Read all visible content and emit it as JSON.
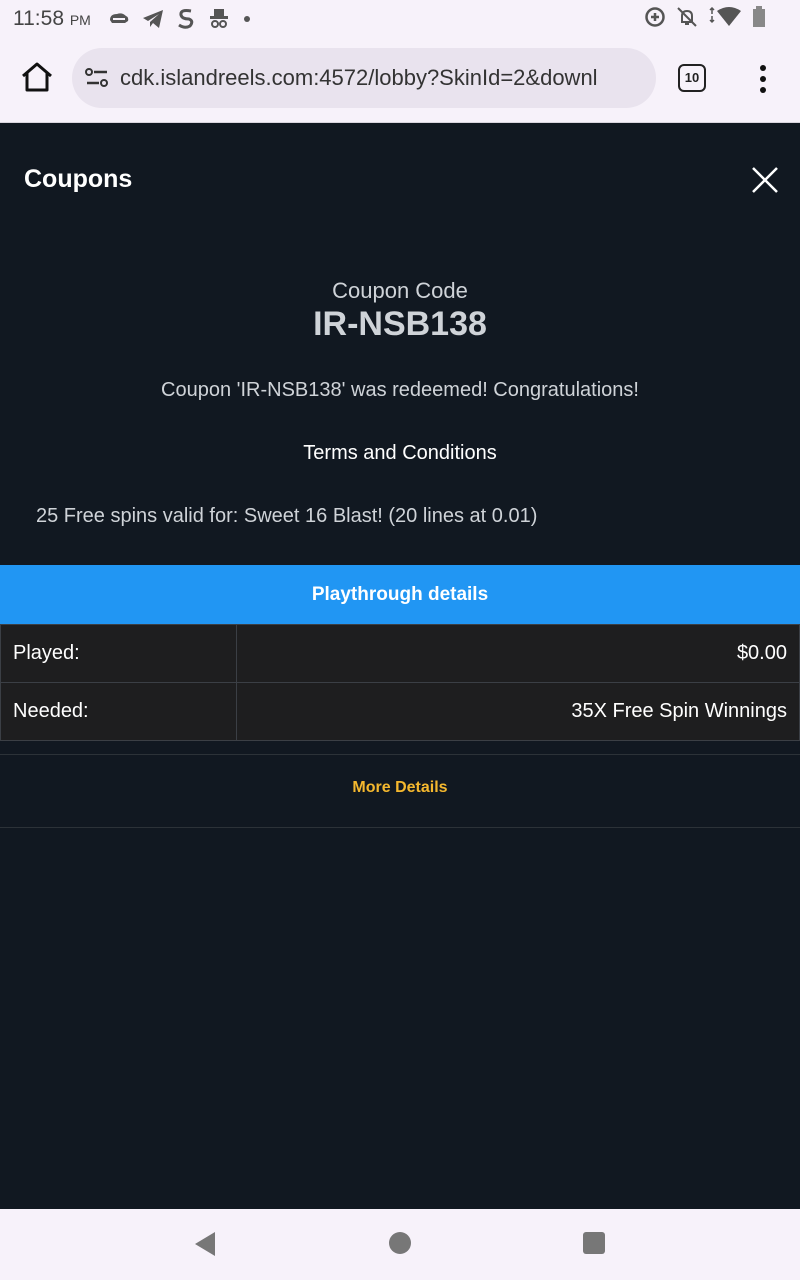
{
  "status_bar": {
    "time": "11:58",
    "ampm": "PM",
    "left_icons": [
      "cloud-icon",
      "telegram-icon",
      "s-icon",
      "spy-icon",
      "dot-icon"
    ],
    "right_icons": [
      "data-saver-icon",
      "notifications-off-icon",
      "wifi-icon",
      "battery-icon"
    ]
  },
  "browser": {
    "url": "cdk.islandreels.com:4572/lobby?SkinId=2&downl",
    "tab_count": "10"
  },
  "page": {
    "title": "Coupons",
    "coupon_label": "Coupon Code",
    "coupon_code": "IR-NSB138",
    "redeemed_message": "Coupon 'IR-NSB138' was redeemed! Congratulations!",
    "terms_heading": "Terms and Conditions",
    "terms_text": "25 Free spins valid for: Sweet 16 Blast! (20 lines at 0.01)",
    "playthrough_header": "Playthrough details",
    "playthrough_rows": [
      {
        "label": "Played:",
        "value": "$0.00"
      },
      {
        "label": "Needed:",
        "value": "35X Free Spin Winnings"
      }
    ],
    "more_details": "More Details"
  },
  "colors": {
    "background": "#111821",
    "accent_blue": "#2196f3",
    "link_yellow": "#f5b82e"
  }
}
